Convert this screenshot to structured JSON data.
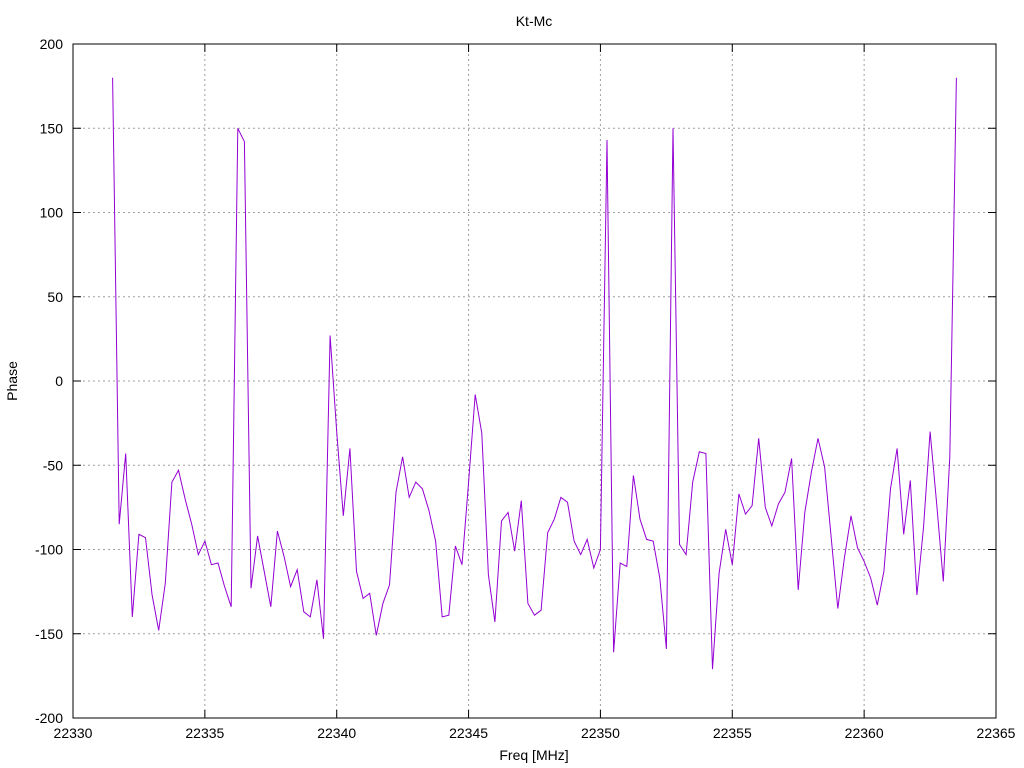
{
  "chart_data": {
    "type": "line",
    "title": "Kt-Mc",
    "xlabel": "Freq [MHz]",
    "ylabel": "Phase",
    "xlim": [
      22330,
      22365
    ],
    "ylim": [
      -200,
      200
    ],
    "x_ticks": [
      22330,
      22335,
      22340,
      22345,
      22350,
      22355,
      22360,
      22365
    ],
    "y_ticks": [
      -200,
      -150,
      -100,
      -50,
      0,
      50,
      100,
      150,
      200
    ],
    "grid": true,
    "line_color": "#9400d3",
    "series": [
      {
        "x": [
          22331.5,
          22331.75,
          22332.0,
          22332.25,
          22332.5,
          22332.75,
          22333.0,
          22333.25,
          22333.5,
          22333.75,
          22334.0,
          22334.25,
          22334.5,
          22334.75,
          22335.0,
          22335.25,
          22335.5,
          22335.75,
          22336.0,
          22336.25,
          22336.5,
          22336.75,
          22337.0,
          22337.25,
          22337.5,
          22337.75,
          22338.0,
          22338.25,
          22338.5,
          22338.75,
          22339.0,
          22339.25,
          22339.5,
          22339.75,
          22340.0,
          22340.25,
          22340.5,
          22340.75,
          22341.0,
          22341.25,
          22341.5,
          22341.75,
          22342.0,
          22342.25,
          22342.5,
          22342.75,
          22343.0,
          22343.25,
          22343.5,
          22343.75,
          22344.0,
          22344.25,
          22344.5,
          22344.75,
          22345.0,
          22345.25,
          22345.5,
          22345.75,
          22346.0,
          22346.25,
          22346.5,
          22346.75,
          22347.0,
          22347.25,
          22347.5,
          22347.75,
          22348.0,
          22348.25,
          22348.5,
          22348.75,
          22349.0,
          22349.25,
          22349.5,
          22349.75,
          22350.0,
          22350.25,
          22350.5,
          22350.75,
          22351.0,
          22351.25,
          22351.5,
          22351.75,
          22352.0,
          22352.25,
          22352.5,
          22352.75,
          22353.0,
          22353.25,
          22353.5,
          22353.75,
          22354.0,
          22354.25,
          22354.5,
          22354.75,
          22355.0,
          22355.25,
          22355.5,
          22355.75,
          22356.0,
          22356.25,
          22356.5,
          22356.75,
          22357.0,
          22357.25,
          22357.5,
          22357.75,
          22358.0,
          22358.25,
          22358.5,
          22358.75,
          22359.0,
          22359.25,
          22359.5,
          22359.75,
          22360.0,
          22360.25,
          22360.5,
          22360.75,
          22361.0,
          22361.25,
          22361.5,
          22361.75,
          22362.0,
          22362.25,
          22362.5,
          22362.75,
          22363.0,
          22363.25,
          22363.5
        ],
        "y": [
          180,
          -85,
          -43,
          -140,
          -91,
          -93,
          -127,
          -148,
          -120,
          -60,
          -53,
          -70,
          -85,
          -103,
          -95,
          -109,
          -108,
          -122,
          -134,
          150,
          142,
          -123,
          -92,
          -113,
          -134,
          -89,
          -104,
          -122,
          -112,
          -137,
          -140,
          -118,
          -153,
          27,
          -30,
          -80,
          -40,
          -113,
          -129,
          -126,
          -151,
          -132,
          -121,
          -66,
          -45,
          -69,
          -60,
          -64,
          -77,
          -95,
          -140,
          -139,
          -98,
          -109,
          -60,
          -8,
          -31,
          -115,
          -143,
          -83,
          -78,
          -101,
          -71,
          -132,
          -139,
          -136,
          -90,
          -82,
          -69,
          -72,
          -95,
          -103,
          -94,
          -111,
          -100,
          143,
          -161,
          -108,
          -110,
          -56,
          -82,
          -94,
          -95,
          -117,
          -159,
          150,
          -97,
          -103,
          -60,
          -42,
          -43,
          -171,
          -114,
          -88,
          -109,
          -67,
          -79,
          -74,
          -34,
          -75,
          -86,
          -73,
          -66,
          -46,
          -124,
          -78,
          -54,
          -34,
          -51,
          -93,
          -135,
          -105,
          -80,
          -99,
          -107,
          -117,
          -133,
          -113,
          -64,
          -40,
          -91,
          -59,
          -127,
          -87,
          -30,
          -73,
          -119,
          -45,
          180
        ]
      }
    ]
  }
}
